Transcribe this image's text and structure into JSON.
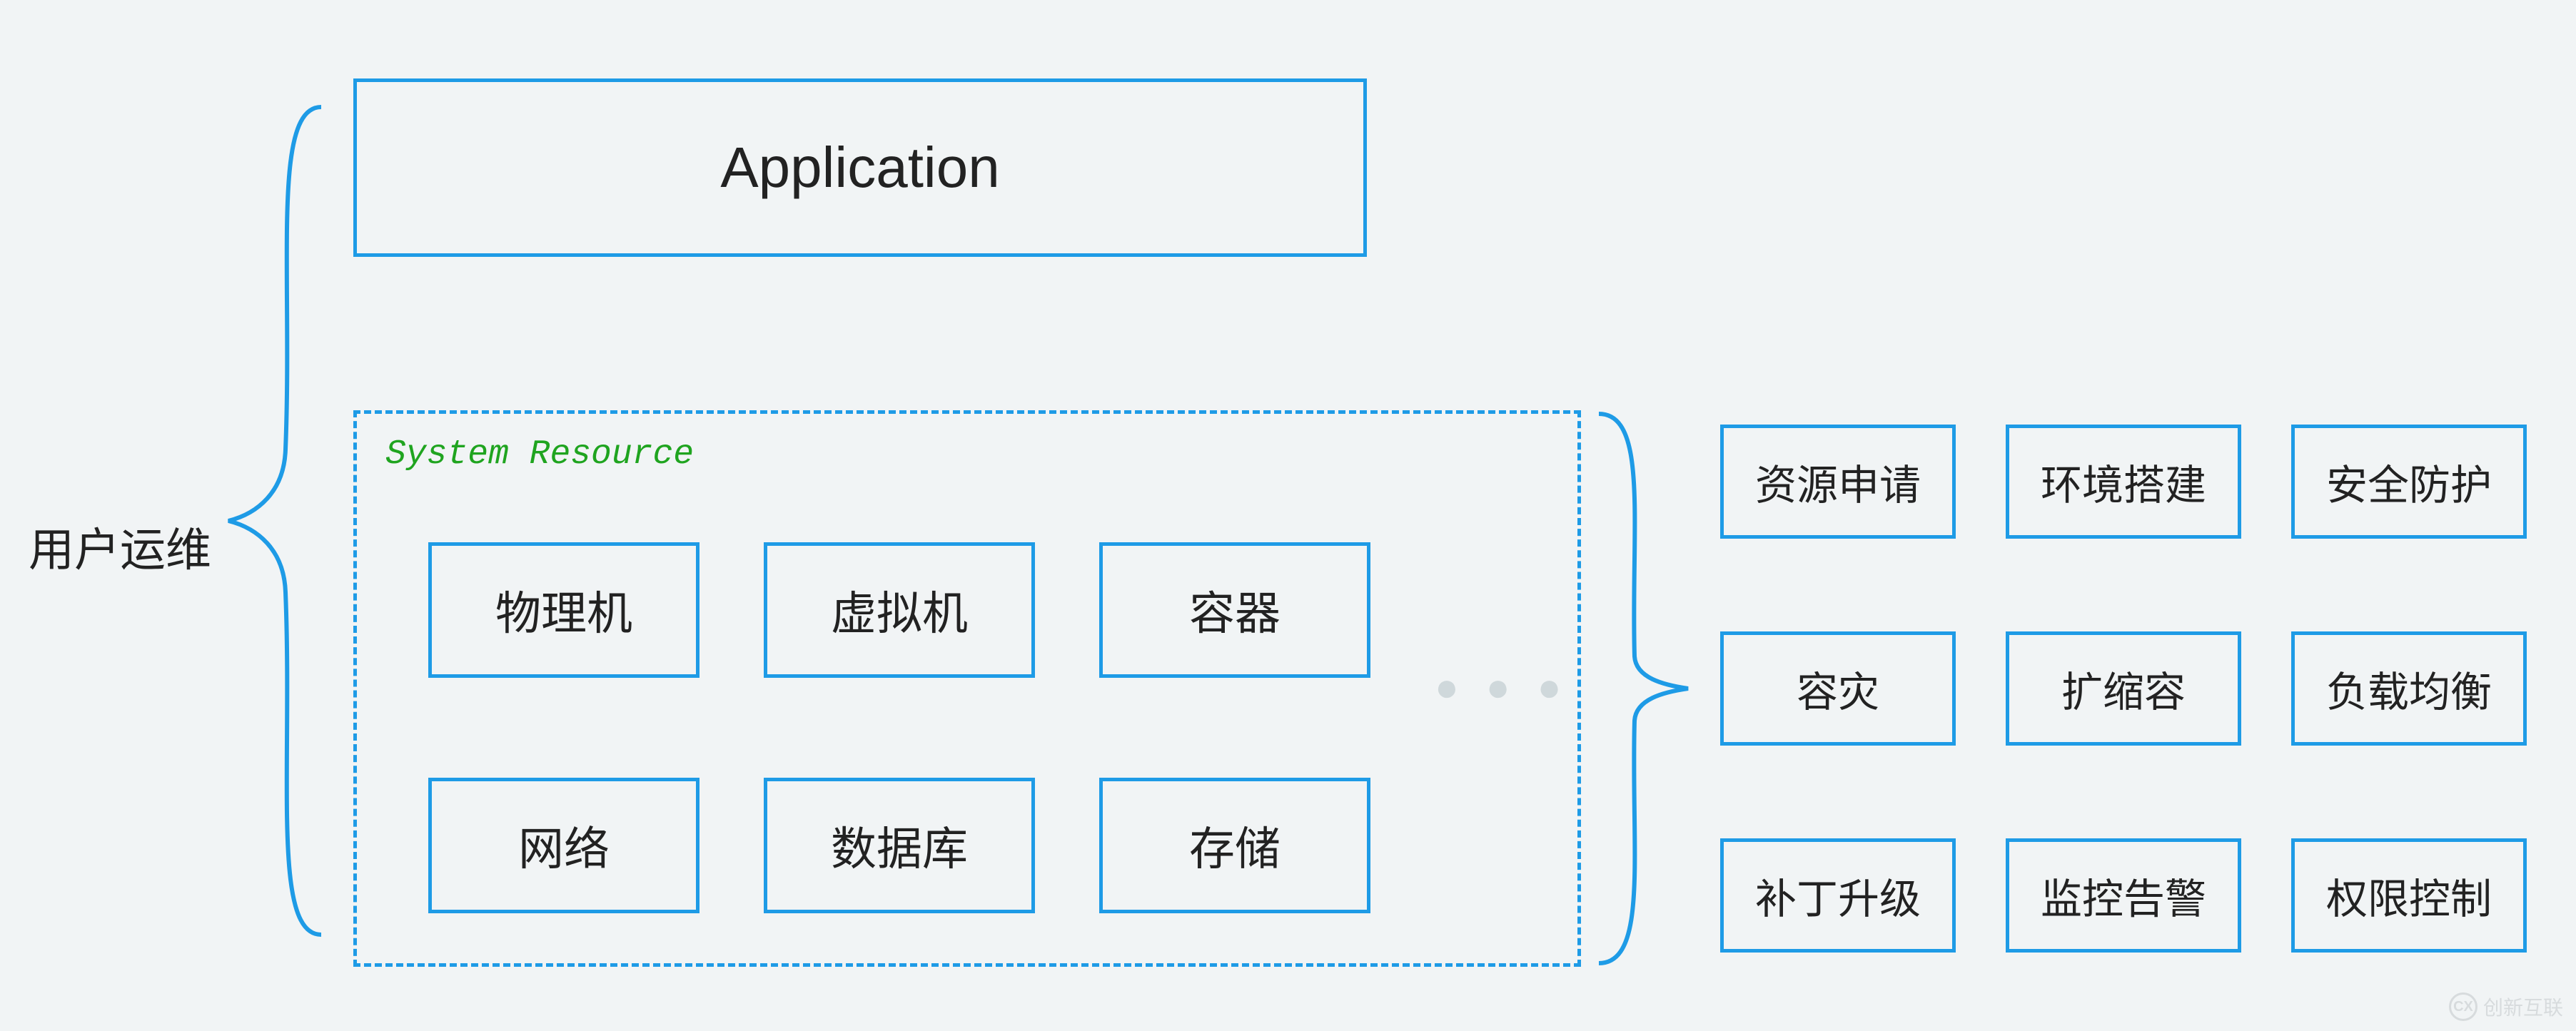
{
  "title_label": "用户运维",
  "application_label": "Application",
  "system_resource_label": "System Resource",
  "resources": {
    "r0": "物理机",
    "r1": "虚拟机",
    "r2": "容器",
    "r3": "网络",
    "r4": "数据库",
    "r5": "存储"
  },
  "ops": {
    "o0": "资源申请",
    "o1": "环境搭建",
    "o2": "安全防护",
    "o3": "容灾",
    "o4": "扩缩容",
    "o5": "负载均衡",
    "o6": "补丁升级",
    "o7": "监控告警",
    "o8": "权限控制"
  },
  "ellipsis": "● ● ●",
  "watermark": "创新互联"
}
